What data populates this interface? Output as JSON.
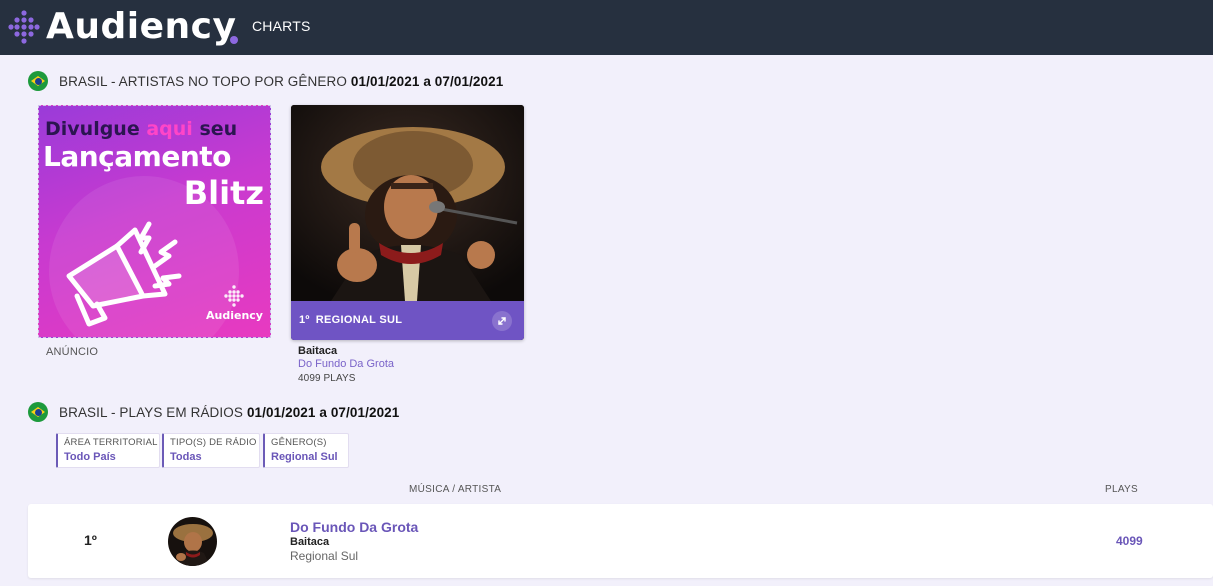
{
  "brand": {
    "name": "Audiency",
    "accent": "#6f54c4",
    "topbar": "#26303f"
  },
  "nav": {
    "charts": "CHARTS"
  },
  "section1": {
    "title": "BRASIL - ARTISTAS NO TOPO POR GÊNERO",
    "dates": "01/01/2021 a 07/01/2021"
  },
  "ad": {
    "line1_a": "Divulgue",
    "line1_b": "aqui",
    "line1_c": "seu",
    "line2": "Lançamento",
    "line3": "Blitz",
    "brand": "Audiency",
    "label": "ANÚNCIO",
    "icon": "megaphone-icon"
  },
  "top_artist": {
    "rank": "1º",
    "genre": "REGIONAL SUL",
    "name": "Baitaca",
    "song": "Do Fundo Da Grota",
    "plays": "4099 PLAYS",
    "expand_icon": "expand-icon"
  },
  "section2": {
    "title": "BRASIL - PLAYS EM RÁDIOS",
    "dates": "01/01/2021 a 07/01/2021"
  },
  "filters": [
    {
      "label": "ÁREA TERRITORIAL",
      "value": "Todo País"
    },
    {
      "label": "TIPO(S) DE RÁDIO",
      "value": "Todas"
    },
    {
      "label": "GÊNERO(S)",
      "value": "Regional Sul"
    }
  ],
  "table": {
    "col_music": "MÚSICA / ARTISTA",
    "col_plays": "PLAYS",
    "rows": [
      {
        "rank": "1º",
        "song": "Do Fundo Da Grota",
        "artist": "Baitaca",
        "genre": "Regional Sul",
        "plays": "4099"
      }
    ]
  }
}
